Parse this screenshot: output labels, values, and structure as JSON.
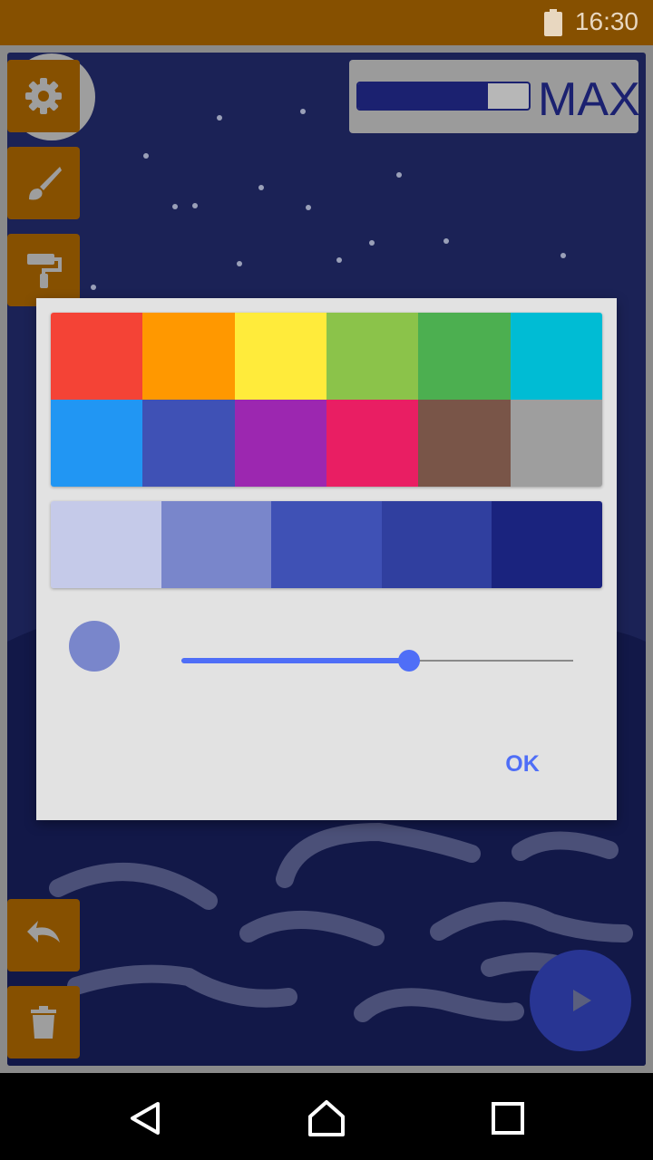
{
  "status_bar": {
    "time": "16:30",
    "battery_icon": "battery-icon"
  },
  "toolbar": {
    "settings_icon": "gear-icon",
    "brush_icon": "brush-icon",
    "fill_icon": "paint-roller-icon",
    "undo_icon": "undo-icon",
    "delete_icon": "trash-icon"
  },
  "power": {
    "label": "MAX",
    "level": 0.76
  },
  "color_dialog": {
    "palette": [
      "#f44336",
      "#ff9800",
      "#ffeb3b",
      "#8bc34a",
      "#4caf50",
      "#00bcd4",
      "#2196f3",
      "#3f51b5",
      "#9c27b0",
      "#e91e63",
      "#795548",
      "#9e9e9e"
    ],
    "shades": [
      "#c5cae9",
      "#7986cb",
      "#3f51b5",
      "#303f9f",
      "#1a237e"
    ],
    "preview_color": "#7986cb",
    "size_value": 0.58,
    "ok_label": "OK"
  },
  "play_button": {
    "icon": "play-icon"
  },
  "nav": {
    "back_icon": "back-triangle-icon",
    "home_icon": "home-icon",
    "recents_icon": "recents-square-icon"
  },
  "colors": {
    "status_bar": "#865000",
    "tool_button": "#865000",
    "sky": "#1b2256",
    "accent": "#4f6ef7",
    "fab": "#283593"
  }
}
